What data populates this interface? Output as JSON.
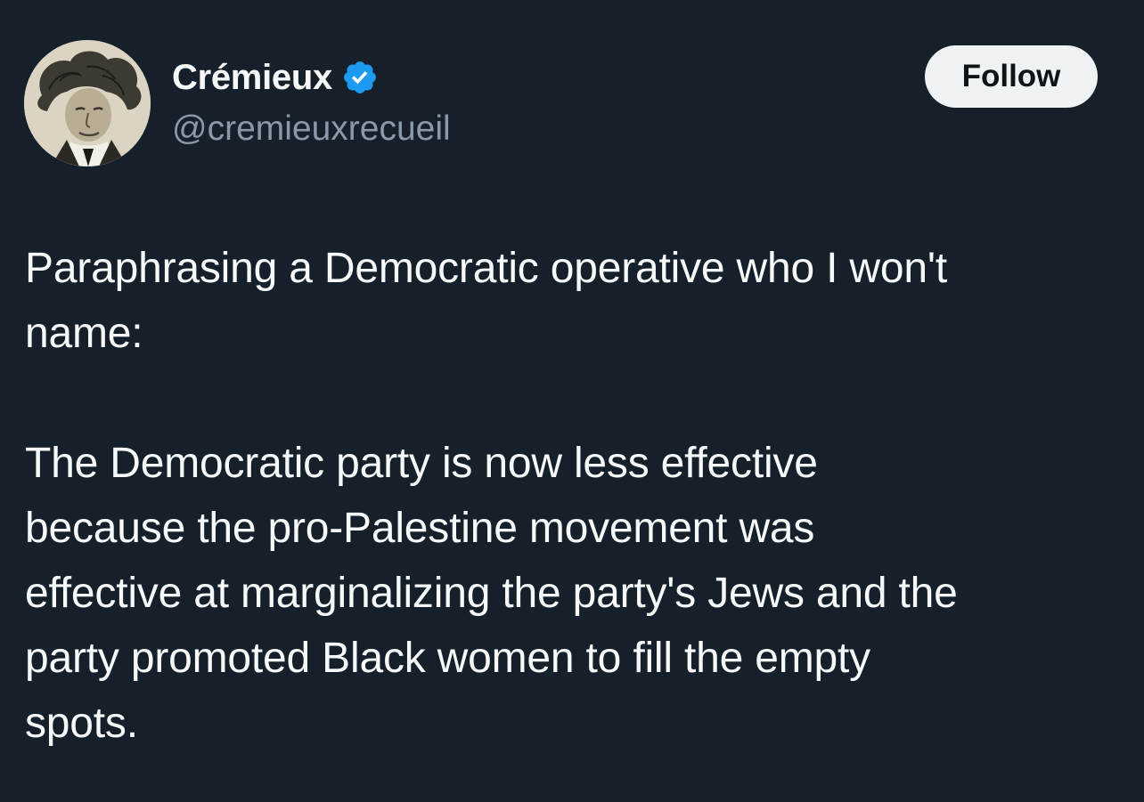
{
  "author": {
    "display_name": "Crémieux",
    "handle": "@cremieuxrecueil",
    "verified": true,
    "avatar_icon": "portrait-caricature-avatar",
    "verified_icon": "verified-badge-icon",
    "verified_color": "#1d9bf0"
  },
  "actions": {
    "follow_label": "Follow"
  },
  "tweet": {
    "paragraphs": [
      [
        "Paraphrasing a Democratic operative who I won't",
        "name:"
      ],
      [
        "The Democratic party is now less effective",
        "because the pro-Palestine movement was",
        "effective at marginalizing the party's Jews and the",
        "party promoted Black women to fill the empty",
        "spots."
      ]
    ]
  },
  "colors": {
    "background": "#15202b",
    "text_primary": "#f7f9f9",
    "text_secondary": "#8b98a5",
    "button_bg": "#eff3f4",
    "button_text": "#0f1419"
  }
}
